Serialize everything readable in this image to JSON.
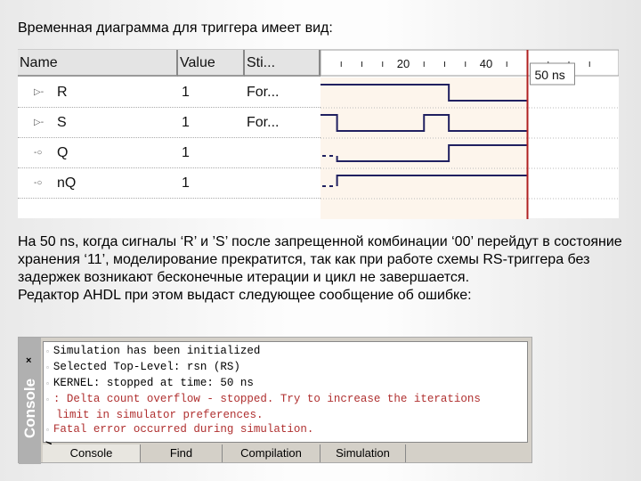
{
  "title": "Временная диаграмма для триггера имеет вид:",
  "paragraph": [
    "На 50 ns, когда сигналы ‘R’ и ’S’ после запрещенной комбинации ‘00’ перейдут в состояние хранения ‘11’, моделирование прекратится, так как при работе схемы RS-триггера без задержек возникают бесконечные итерации и цикл не завершается.",
    "Редактор AHDL при этом выдаст следующее сообщение об ошибке:"
  ],
  "waveform": {
    "columns": {
      "name": "Name",
      "value": "Value",
      "stimulus": "Sti..."
    },
    "ticks": [
      "20",
      "40"
    ],
    "cursor_label": "50 ns",
    "cursor_time": 50,
    "signals": [
      {
        "name": "R",
        "value": "1",
        "stimulus": "For...",
        "direction": "input",
        "init": 1,
        "transitions": [
          31
        ]
      },
      {
        "name": "S",
        "value": "1",
        "stimulus": "For...",
        "direction": "input",
        "init": 1,
        "transitions": [
          4,
          25,
          31
        ]
      },
      {
        "name": "Q",
        "value": "1",
        "stimulus": "",
        "direction": "output",
        "init": "X",
        "undefined_until": 4,
        "init_after": 0,
        "transitions": [
          31
        ]
      },
      {
        "name": "nQ",
        "value": "1",
        "stimulus": "",
        "direction": "output",
        "init": "X",
        "undefined_until": 4,
        "init_after": 1,
        "transitions": []
      }
    ],
    "colors": {
      "cursor": "#b02020",
      "shade": "#fdf5ec",
      "trace": "#202060"
    }
  },
  "console": {
    "side_label": "Console",
    "close": "×",
    "lines": [
      {
        "text": "Simulation has been initialized",
        "error": false
      },
      {
        "text": "Selected Top-Level: rsn (RS)",
        "error": false
      },
      {
        "text": "KERNEL: stopped at time: 50 ns",
        "error": false
      },
      {
        "text": ": Delta count overflow - stopped. Try to increase the iterations",
        "error": true
      },
      {
        "text": "limit in simulator preferences.",
        "error": true,
        "cont": true
      },
      {
        "text": "Fatal error occurred during simulation.",
        "error": true
      }
    ],
    "prompt": ">",
    "tabs": [
      "Console",
      "Find",
      "Compilation",
      "Simulation"
    ]
  }
}
